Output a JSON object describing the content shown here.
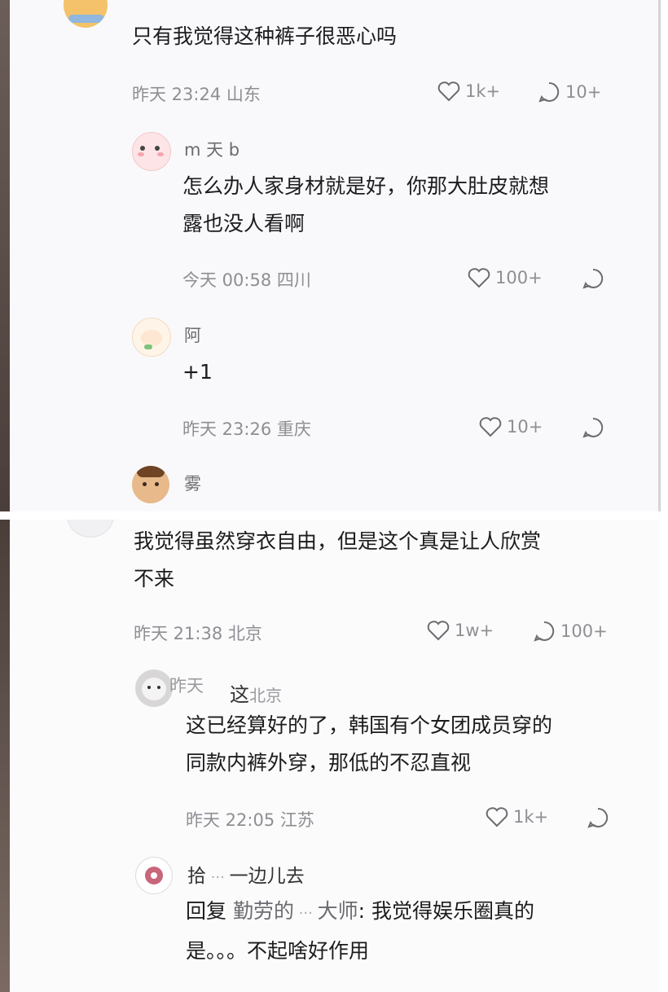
{
  "panel1": {
    "comment": {
      "text": "只有我觉得这种裤子很恶心吗",
      "time": "昨天 23:24",
      "location": "山东",
      "likes": "1k+",
      "replies": "10+"
    },
    "reply1": {
      "username": "m 天 b",
      "text_line1": "怎么办人家身材就是好，你那大肚皮就想",
      "text_line2": "露也没人看啊",
      "time": "今天 00:58",
      "location": "四川",
      "likes": "100+"
    },
    "reply2": {
      "username": "阿",
      "text": "+1",
      "time": "昨天 23:26",
      "location": "重庆",
      "likes": "10+"
    },
    "reply3": {
      "username": "雾"
    }
  },
  "panel2": {
    "comment": {
      "text_line1": "我觉得虽然穿衣自由，但是这个真是让人欣赏",
      "text_line2": "不来",
      "time": "昨天 21:38",
      "location": "北京",
      "likes": "1w+",
      "replies": "100+"
    },
    "reply1": {
      "username": "这",
      "overlay_text": "昨天",
      "overlay_text2": "北京",
      "text_line1": "这已经算好的了，韩国有个女团成员穿的",
      "text_line2": "同款内裤外穿，那低的不忍直视",
      "time": "昨天 22:05",
      "location": "江苏",
      "likes": "1k+"
    },
    "reply2": {
      "username": "拾",
      "username_rest": "一边儿去",
      "reply_prefix": "回复",
      "reply_to": "勤劳的",
      "reply_to_rest": "大师",
      "text_rest": ": 我觉得娱乐圈真的",
      "text_line2": "是。。。不起啥好作用"
    }
  },
  "icons": {
    "heart": "heart-icon",
    "comment": "comment-bubble-icon"
  },
  "colors": {
    "text": "#1c1c1e",
    "meta": "#8e8e93"
  }
}
